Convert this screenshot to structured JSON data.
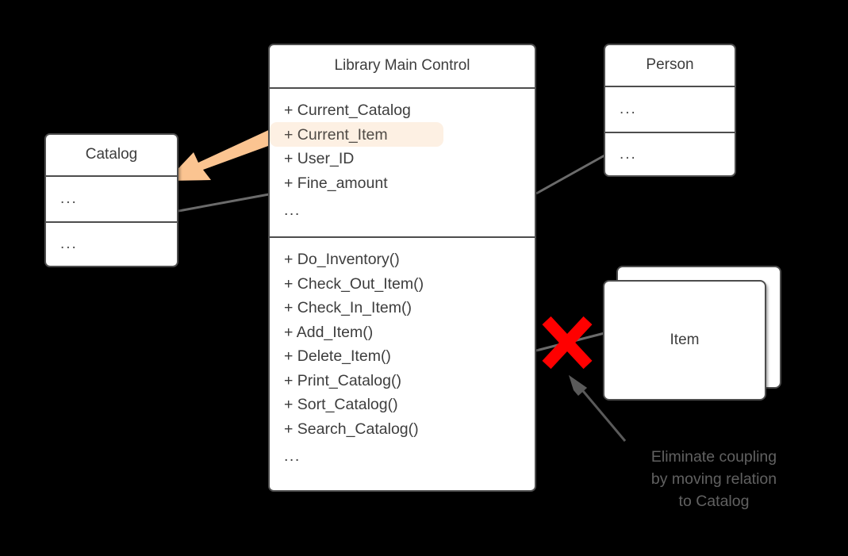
{
  "diagram": {
    "type": "uml-class-diagram",
    "background_color": "#000000",
    "box_border_color": "#4d4d4d",
    "box_fill_color": "#ffffff",
    "text_color": "#3d3d3d",
    "connector_color": "#6b6b6b",
    "highlight_color": "#fdf0e3",
    "callout_arrow_color": "#fbc491",
    "cross_color": "#ff0000",
    "annotation_color": "#616161"
  },
  "classes": {
    "catalog": {
      "name": "Catalog",
      "attributes": "...",
      "operations": "..."
    },
    "library_main_control": {
      "name": "Library Main Control",
      "attributes": [
        {
          "text": "+ Current_Catalog",
          "highlighted": false
        },
        {
          "text": "+ Current_Item",
          "highlighted": true
        },
        {
          "text": "+ User_ID",
          "highlighted": false
        },
        {
          "text": "+ Fine_amount",
          "highlighted": false
        },
        {
          "text": "...",
          "highlighted": false
        }
      ],
      "operations": [
        "+ Do_Inventory()",
        "+ Check_Out_Item()",
        "+ Check_In_Item()",
        "+ Add_Item()",
        "+ Delete_Item()",
        "+ Print_Catalog()",
        "+ Sort_Catalog()",
        "+ Search_Catalog()",
        "..."
      ]
    },
    "person": {
      "name": "Person",
      "attributes": "...",
      "operations": "..."
    },
    "item": {
      "name": "Item"
    }
  },
  "annotations": {
    "eliminate_coupling": {
      "line1": "Eliminate coupling",
      "line2": "by moving relation",
      "line3": "to Catalog"
    }
  },
  "markers": {
    "deleted_relation": "✕"
  }
}
